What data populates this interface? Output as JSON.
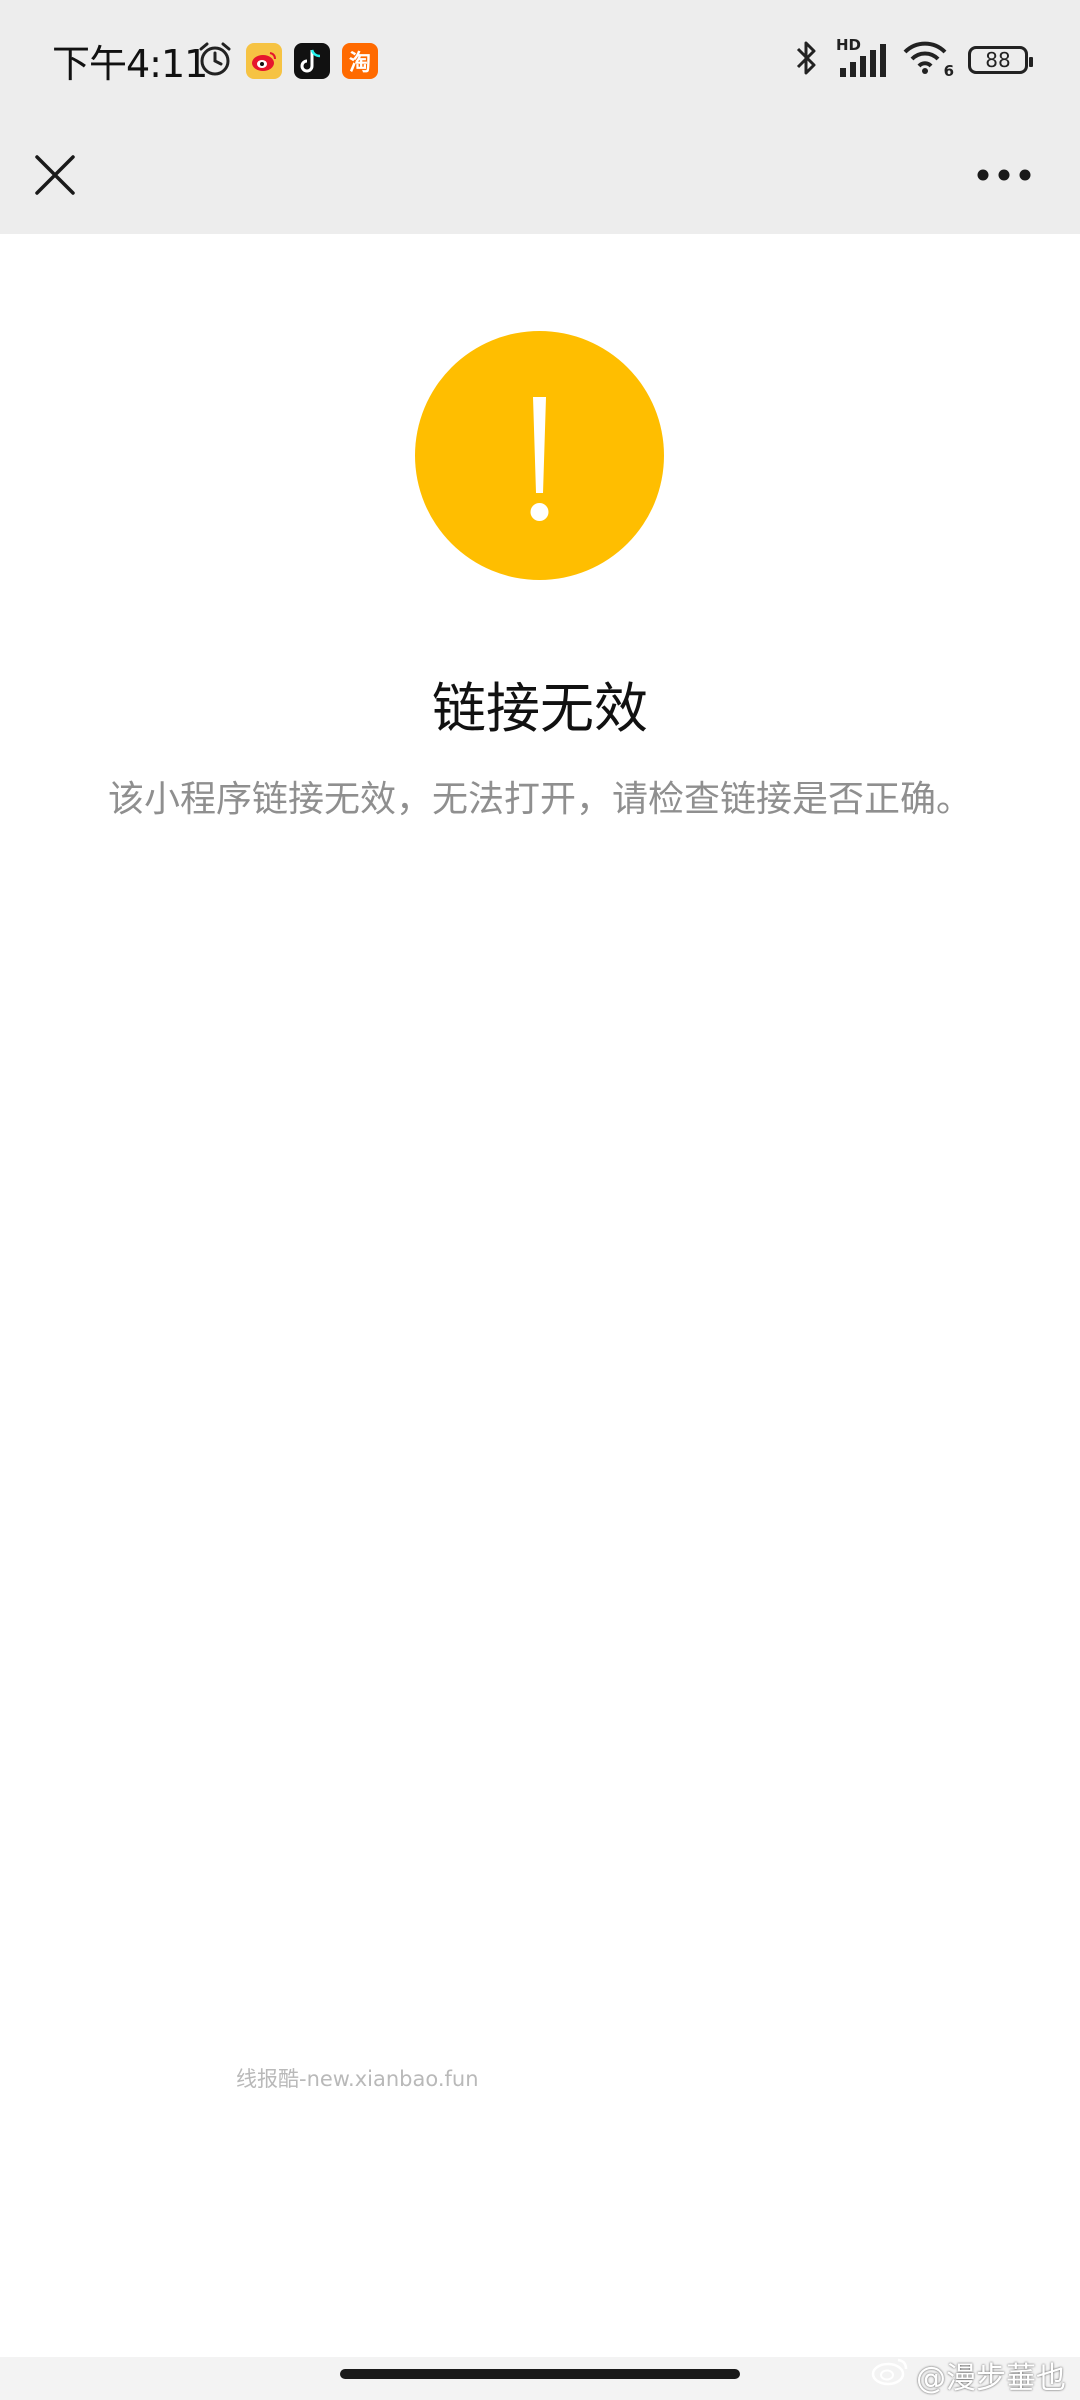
{
  "status_bar": {
    "time": "下午4:11",
    "battery": "88",
    "network_label": "HD",
    "wifi_label": "6",
    "taobao_glyph": "淘",
    "icons": [
      "alarm-icon",
      "weibo-app-icon",
      "douyin-app-icon",
      "taobao-app-icon",
      "bluetooth-icon",
      "signal-icon",
      "wifi-icon",
      "battery-icon"
    ]
  },
  "nav": {
    "close_icon": "close-icon",
    "more_icon": "more-icon"
  },
  "main": {
    "icon": "warning-icon",
    "title": "链接无效",
    "description": "该小程序链接无效，无法打开，请检查链接是否正确。"
  },
  "watermark": "线报酷-new.xianbao.fun",
  "credit": "@漫步菙也",
  "colors": {
    "header_bg": "#ededed",
    "warning": "#ffbe00",
    "description": "#8f8f8f"
  }
}
